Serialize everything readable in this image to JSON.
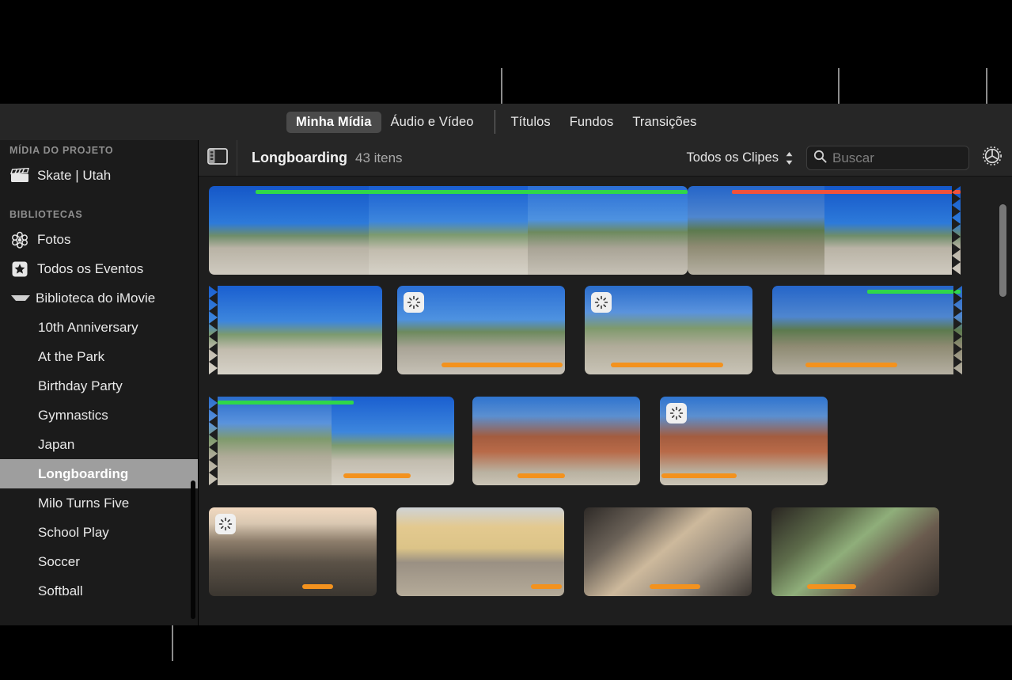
{
  "tabs": [
    {
      "label": "Minha Mídia",
      "selected": true
    },
    {
      "label": "Áudio e Vídeo",
      "selected": false
    },
    {
      "label": "Títulos",
      "selected": false
    },
    {
      "label": "Fundos",
      "selected": false
    },
    {
      "label": "Transições",
      "selected": false
    }
  ],
  "sidebar": {
    "project_media_header": "MÍDIA DO PROJETO",
    "project_item": {
      "label": "Skate | Utah",
      "icon": "clapperboard-icon"
    },
    "libraries_header": "BIBLIOTECAS",
    "library_items": [
      {
        "label": "Fotos",
        "icon": "photos-flower-icon"
      },
      {
        "label": "Todos os Eventos",
        "icon": "star-icon"
      }
    ],
    "imovie_library": {
      "label": "Biblioteca do iMovie",
      "icon": "disclosure-triangle-icon",
      "expanded": true
    },
    "events": [
      {
        "label": "10th Anniversary",
        "selected": false
      },
      {
        "label": "At the Park",
        "selected": false
      },
      {
        "label": "Birthday Party",
        "selected": false
      },
      {
        "label": "Gymnastics",
        "selected": false
      },
      {
        "label": "Japan",
        "selected": false
      },
      {
        "label": "Longboarding",
        "selected": true
      },
      {
        "label": "Milo Turns Five",
        "selected": false
      },
      {
        "label": "School Play",
        "selected": false
      },
      {
        "label": "Soccer",
        "selected": false
      },
      {
        "label": "Softball",
        "selected": false
      }
    ]
  },
  "toolbar": {
    "sidebar_toggle_icon": "sidebar-toggle-icon",
    "title": "Longboarding",
    "item_count": "43 itens",
    "filter_popup": "Todos os Clipes",
    "search_placeholder": "Buscar",
    "search_value": "",
    "search_icon": "search-icon",
    "settings_icon": "gear-icon"
  },
  "colors": {
    "green_bar": "#2fd74a",
    "red_bar": "#f0523c",
    "orange_bar": "#f3921e",
    "selection": "#9e9e9e",
    "window_bg": "#1e1e1e",
    "toolbar_bg": "#262626"
  },
  "media_rows": [
    {
      "clips": [
        {
          "name": "longboard-filmstrip-1",
          "markers": [
            "green"
          ],
          "badge": false,
          "torn_right": false
        },
        {
          "name": "longboard-filmstrip-2",
          "markers": [
            "red"
          ],
          "badge": false,
          "torn_right": true
        }
      ]
    },
    {
      "clips": [
        {
          "name": "skater-yellow-helmet",
          "markers": [],
          "badge": false,
          "torn_left": true
        },
        {
          "name": "skater-downhill-group",
          "markers": [
            "orange"
          ],
          "badge": true
        },
        {
          "name": "skater-teal-shirt-overlook",
          "markers": [
            "orange"
          ],
          "badge": true
        },
        {
          "name": "skater-red-helmet-hills",
          "markers": [
            "green",
            "orange"
          ],
          "badge": false,
          "torn_right": true
        }
      ]
    },
    {
      "clips": [
        {
          "name": "skater-crouch-closeup",
          "markers": [
            "green",
            "orange"
          ],
          "badge": false,
          "torn_left": true
        },
        {
          "name": "skater-red-rock-canyon",
          "markers": [
            "orange"
          ],
          "badge": false
        },
        {
          "name": "skater-red-rock-wide",
          "markers": [
            "orange"
          ],
          "badge": true
        }
      ]
    },
    {
      "clips": [
        {
          "name": "sunset-road",
          "markers": [
            "orange"
          ],
          "badge": true
        },
        {
          "name": "crossroads-trading-post-group",
          "markers": [
            "orange"
          ],
          "badge": false
        },
        {
          "name": "van-rider-laughing",
          "markers": [
            "orange"
          ],
          "badge": false
        },
        {
          "name": "van-rider-talking",
          "markers": [
            "orange"
          ],
          "badge": false
        }
      ]
    }
  ],
  "scrollbars": {
    "grid_vertical": "grid-vertical-scrollbar",
    "sidebar_vertical": "sidebar-vertical-scrollbar"
  }
}
